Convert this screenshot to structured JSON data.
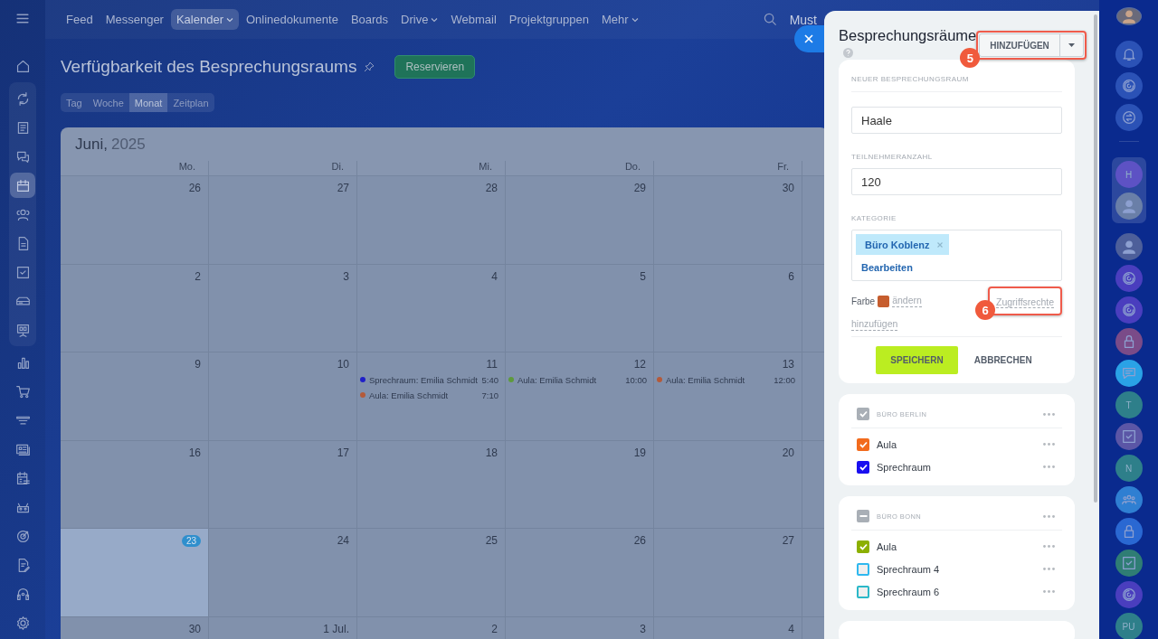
{
  "sidebar": {
    "items_top": [
      {
        "kind": "home",
        "selected": false
      }
    ],
    "group": {
      "items": [
        {
          "kind": "flow",
          "selected": false
        },
        {
          "kind": "news",
          "selected": false
        },
        {
          "kind": "chat",
          "selected": false
        },
        {
          "kind": "calendar",
          "selected": true
        },
        {
          "kind": "contacts",
          "selected": false
        },
        {
          "kind": "doc",
          "selected": false
        },
        {
          "kind": "task",
          "selected": false
        },
        {
          "kind": "drive",
          "selected": false
        },
        {
          "kind": "board",
          "selected": false
        }
      ]
    },
    "items_bottom": [
      {
        "kind": "chart",
        "selected": false
      },
      {
        "kind": "cart",
        "selected": false
      },
      {
        "kind": "funnel",
        "selected": false
      },
      {
        "kind": "card",
        "selected": false
      },
      {
        "kind": "schedule",
        "selected": false
      },
      {
        "kind": "robot",
        "selected": false
      },
      {
        "kind": "target",
        "selected": false
      },
      {
        "kind": "docedit",
        "selected": false
      },
      {
        "kind": "headset",
        "selected": false
      },
      {
        "kind": "gear",
        "selected": false
      }
    ]
  },
  "nav": {
    "items": [
      {
        "label": "Feed",
        "selected": false,
        "dropdown": false
      },
      {
        "label": "Messenger",
        "selected": false,
        "dropdown": false
      },
      {
        "label": "Kalender",
        "selected": true,
        "dropdown": true
      },
      {
        "label": "Onlinedokumente",
        "selected": false,
        "dropdown": false
      },
      {
        "label": "Boards",
        "selected": false,
        "dropdown": false
      },
      {
        "label": "Drive",
        "selected": false,
        "dropdown": true
      },
      {
        "label": "Webmail",
        "selected": false,
        "dropdown": false
      },
      {
        "label": "Projektgruppen",
        "selected": false,
        "dropdown": false
      },
      {
        "label": "Mehr",
        "selected": false,
        "dropdown": true
      }
    ],
    "user_name": "Must"
  },
  "page": {
    "title": "Verfügbarkeit des Besprechungsraums",
    "reserve_button": "Reservieren",
    "view_tabs": [
      {
        "label": "Tag",
        "selected": false
      },
      {
        "label": "Woche",
        "selected": false
      },
      {
        "label": "Monat",
        "selected": true
      },
      {
        "label": "Zeitplan",
        "selected": false
      }
    ]
  },
  "calendar": {
    "month": "Juni,",
    "year": "2025",
    "weekdays": [
      "Mo.",
      "Di.",
      "Mi.",
      "Do.",
      "Fr."
    ],
    "weeks": [
      {
        "days": [
          {
            "label": "26",
            "today": false
          },
          {
            "label": "27",
            "today": false
          },
          {
            "label": "28",
            "today": false
          },
          {
            "label": "29",
            "today": false
          },
          {
            "label": "30",
            "today": false
          }
        ]
      },
      {
        "days": [
          {
            "label": "2",
            "today": false
          },
          {
            "label": "3",
            "today": false
          },
          {
            "label": "4",
            "today": false
          },
          {
            "label": "5",
            "today": false
          },
          {
            "label": "6",
            "today": false
          }
        ]
      },
      {
        "days": [
          {
            "label": "9",
            "today": false
          },
          {
            "label": "10",
            "today": false
          },
          {
            "label": "11",
            "today": false,
            "events": [
              {
                "title": "Sprechraum: Emilia Schmidt",
                "time": "5:40",
                "color": "#1f1fc8"
              },
              {
                "title": "Aula: Emilia Schmidt",
                "time": "7:10",
                "color": "#b45a3a"
              }
            ]
          },
          {
            "label": "12",
            "today": false,
            "events": [
              {
                "title": "Aula: Emilia Schmidt",
                "time": "10:00",
                "color": "#5e9a3c"
              }
            ]
          },
          {
            "label": "13",
            "today": false,
            "events": [
              {
                "title": "Aula: Emilia Schmidt",
                "time": "12:00",
                "color": "#b45a3a"
              }
            ]
          }
        ]
      },
      {
        "days": [
          {
            "label": "16",
            "today": false
          },
          {
            "label": "17",
            "today": false
          },
          {
            "label": "18",
            "today": false
          },
          {
            "label": "19",
            "today": false
          },
          {
            "label": "20",
            "today": false
          }
        ]
      },
      {
        "days": [
          {
            "label": "23",
            "today": true
          },
          {
            "label": "24",
            "today": false
          },
          {
            "label": "25",
            "today": false
          },
          {
            "label": "26",
            "today": false
          },
          {
            "label": "27",
            "today": false
          }
        ]
      },
      {
        "days": [
          {
            "label": "30",
            "today": false
          },
          {
            "label": "1 Jul.",
            "today": false
          },
          {
            "label": "2",
            "today": false
          },
          {
            "label": "3",
            "today": false
          },
          {
            "label": "4",
            "today": false
          }
        ]
      }
    ]
  },
  "panel": {
    "title": "Besprechungsräume",
    "add_button": {
      "label": "HINZUFÜGEN",
      "callout": "5"
    },
    "form": {
      "heading": "NEUER BESPRECHUNGSRAUM",
      "name_field": {
        "value": "Haale"
      },
      "capacity_label": "TEILNEHMERANZAHL",
      "capacity_field": {
        "value": "120"
      },
      "category_label": "KATEGORIE",
      "category_tags": [
        "Büro Koblenz"
      ],
      "edit_link": "Bearbeiten",
      "color_label": "Farbe",
      "color": "#c65d2e",
      "change_link": "ändern",
      "access_link": {
        "label": "Zugriffsrechte",
        "callout": "6"
      },
      "add_link": "hinzufügen",
      "save_button": "SPEICHERN",
      "cancel_button": "ABBRECHEN"
    },
    "groups": [
      {
        "name": "BÜRO BERLIN",
        "checked": true,
        "indeterminate": false,
        "rooms": [
          {
            "name": "Aula",
            "checked": true,
            "color": "#f26b1d"
          },
          {
            "name": "Sprechraum",
            "checked": true,
            "color": "#1a0ff0"
          }
        ]
      },
      {
        "name": "BÜRO BONN",
        "checked": false,
        "indeterminate": true,
        "rooms": [
          {
            "name": "Aula",
            "checked": true,
            "color": "#8cb000"
          },
          {
            "name": "Sprechraum 4",
            "checked": false,
            "color": "#2fb8ef"
          },
          {
            "name": "Sprechraum 6",
            "checked": false,
            "color": "#2bb8c8"
          }
        ]
      }
    ]
  },
  "right_bar": {
    "items_top": [
      {
        "kind": "bell",
        "color": "#2b52b6"
      },
      {
        "kind": "spiral",
        "color": "#2b52b6"
      },
      {
        "kind": "chatswap",
        "color": "#2b52b6"
      }
    ],
    "group": {
      "items": [
        {
          "kind": "letter",
          "letter": "H",
          "color": "#5d52c4"
        },
        {
          "kind": "person",
          "color": "#6a7fa8"
        }
      ]
    },
    "items": [
      {
        "kind": "person",
        "color": "#4d5f9a"
      },
      {
        "kind": "spiral",
        "color": "#4a3ebe"
      },
      {
        "kind": "spiral",
        "color": "#4a3ebe"
      },
      {
        "kind": "lock",
        "color": "#7a4b88"
      },
      {
        "kind": "message",
        "color": "#2aa2e6"
      },
      {
        "kind": "letter",
        "letter": "T",
        "color": "#2e7f8a"
      },
      {
        "kind": "task",
        "color": "#5b56a6"
      },
      {
        "kind": "letter",
        "letter": "N",
        "color": "#2e7f8a"
      },
      {
        "kind": "people",
        "color": "#2f7fd2"
      },
      {
        "kind": "lock",
        "color": "#2a68d2"
      },
      {
        "kind": "task",
        "color": "#2f7d74"
      },
      {
        "kind": "spiral",
        "color": "#4a3ebe"
      },
      {
        "kind": "letter",
        "letter": "PU",
        "color": "#2e7f8a"
      }
    ]
  }
}
